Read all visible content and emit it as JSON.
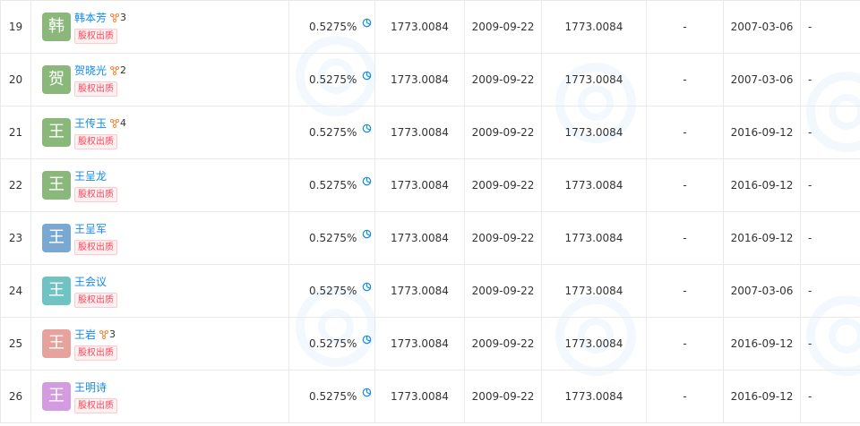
{
  "colors": {
    "link": "#128bed",
    "tag_text": "#fd485e",
    "tag_bg": "#fff0f0",
    "avatar_green": "#8ab87a",
    "avatar_blue": "#79a9d3",
    "avatar_teal": "#6fc3c2",
    "avatar_pink": "#e6a29d",
    "avatar_purple": "#d49be0"
  },
  "icons": {
    "relation": "relation-network-icon",
    "chart": "pie-chart-icon"
  },
  "rows": [
    {
      "index": "19",
      "avatar_char": "韩",
      "avatar_color": "#8ab87a",
      "name": "韩本芳",
      "relations": "3",
      "tag": "股权出质",
      "ratio": "0.5275%",
      "amount1": "1773.0084",
      "date1": "2009-09-22",
      "amount2": "1773.0084",
      "col7": "-",
      "date2": "2007-03-06",
      "col9": "-"
    },
    {
      "index": "20",
      "avatar_char": "贺",
      "avatar_color": "#8ab87a",
      "name": "贺晓光",
      "relations": "2",
      "tag": "股权出质",
      "ratio": "0.5275%",
      "amount1": "1773.0084",
      "date1": "2009-09-22",
      "amount2": "1773.0084",
      "col7": "-",
      "date2": "2007-03-06",
      "col9": "-"
    },
    {
      "index": "21",
      "avatar_char": "王",
      "avatar_color": "#8ab87a",
      "name": "王传玉",
      "relations": "4",
      "tag": "股权出质",
      "ratio": "0.5275%",
      "amount1": "1773.0084",
      "date1": "2009-09-22",
      "amount2": "1773.0084",
      "col7": "-",
      "date2": "2016-09-12",
      "col9": "-"
    },
    {
      "index": "22",
      "avatar_char": "王",
      "avatar_color": "#8ab87a",
      "name": "王呈龙",
      "relations": "",
      "tag": "股权出质",
      "ratio": "0.5275%",
      "amount1": "1773.0084",
      "date1": "2009-09-22",
      "amount2": "1773.0084",
      "col7": "-",
      "date2": "2016-09-12",
      "col9": "-"
    },
    {
      "index": "23",
      "avatar_char": "王",
      "avatar_color": "#79a9d3",
      "name": "王呈军",
      "relations": "",
      "tag": "股权出质",
      "ratio": "0.5275%",
      "amount1": "1773.0084",
      "date1": "2009-09-22",
      "amount2": "1773.0084",
      "col7": "-",
      "date2": "2016-09-12",
      "col9": "-"
    },
    {
      "index": "24",
      "avatar_char": "王",
      "avatar_color": "#6fc3c2",
      "name": "王会议",
      "relations": "",
      "tag": "股权出质",
      "ratio": "0.5275%",
      "amount1": "1773.0084",
      "date1": "2009-09-22",
      "amount2": "1773.0084",
      "col7": "-",
      "date2": "2007-03-06",
      "col9": "-"
    },
    {
      "index": "25",
      "avatar_char": "王",
      "avatar_color": "#e6a29d",
      "name": "王岩",
      "relations": "3",
      "tag": "股权出质",
      "ratio": "0.5275%",
      "amount1": "1773.0084",
      "date1": "2009-09-22",
      "amount2": "1773.0084",
      "col7": "-",
      "date2": "2016-09-12",
      "col9": "-"
    },
    {
      "index": "26",
      "avatar_char": "王",
      "avatar_color": "#d49be0",
      "name": "王明诗",
      "relations": "",
      "tag": "股权出质",
      "ratio": "0.5275%",
      "amount1": "1773.0084",
      "date1": "2009-09-22",
      "amount2": "1773.0084",
      "col7": "-",
      "date2": "2016-09-12",
      "col9": "-"
    }
  ]
}
